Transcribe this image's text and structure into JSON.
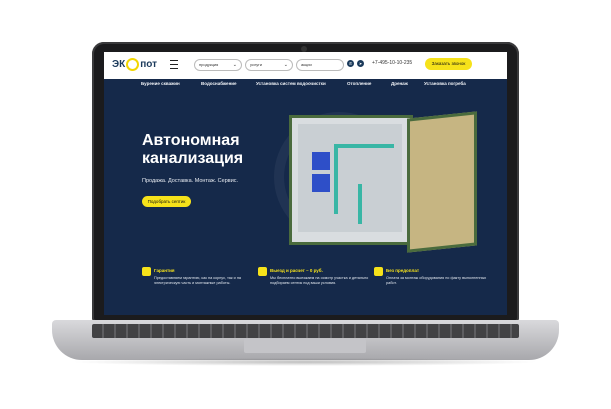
{
  "header": {
    "logo_prefix": "ЭК",
    "logo_suffix": "пот",
    "menu_products": "продукция",
    "menu_services": "услуги",
    "menu_promo": "акции",
    "phone": "+7-495-10-10-235",
    "callback_label": "Заказать звонок"
  },
  "nav": [
    "Бурение скважин",
    "Водоснабжение",
    "Установка систем водоочистки",
    "Отопление",
    "Дренаж",
    "Установка погреба"
  ],
  "hero": {
    "title": "Автономная канализация",
    "subtitle": "Продажа. Доставка. Монтаж. Сервис.",
    "cta_label": "Подобрать септик"
  },
  "features": [
    {
      "title": "Гарантия",
      "text": "Предоставляем гарантию, как на корпус, так и на электрическую часть и монтажные работы."
    },
    {
      "title": "Выезд и расчет – 0 руб.",
      "text": "Мы бесплатно выезжаем на осмотр участка и детально подбираем септик под ваши условия."
    },
    {
      "title": "Без предоплат",
      "text": "Оплата за монтаж оборудования по факту выполненных работ."
    }
  ],
  "colors": {
    "brand_dark": "#15294a",
    "accent_yellow": "#f6e21a",
    "pipe_teal": "#38b6a5",
    "tank_blue": "#2e4fc8"
  }
}
